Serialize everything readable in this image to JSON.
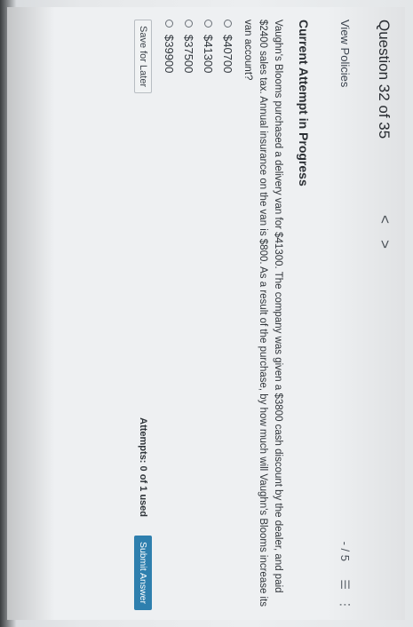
{
  "header": {
    "question_title": "Question 32 of 35",
    "prev_label": "<",
    "next_label": ">"
  },
  "subheader": {
    "view_policies": "View Policies",
    "score": "- / 5",
    "list_icon": "list-icon",
    "more_icon": "more-vertical-icon"
  },
  "main": {
    "section_title": "Current Attempt in Progress",
    "question": "Vaughn's Blooms purchased a delivery van for $41300. The company was given a $3800 cash discount by the dealer, and paid $2400 sales tax. Annual insurance on the van is $800. As a result of the purchase, by how much will Vaughn's Blooms increase its van account?",
    "options": [
      {
        "label": "$40700"
      },
      {
        "label": "$41300"
      },
      {
        "label": "$37500"
      },
      {
        "label": "$39900"
      }
    ]
  },
  "footer": {
    "save_later": "Save for Later",
    "attempts": "Attempts: 0 of 1 used",
    "submit": "Submit Answer"
  },
  "colors": {
    "submit_bg": "#2e7fae",
    "background": "#eef0f2"
  }
}
